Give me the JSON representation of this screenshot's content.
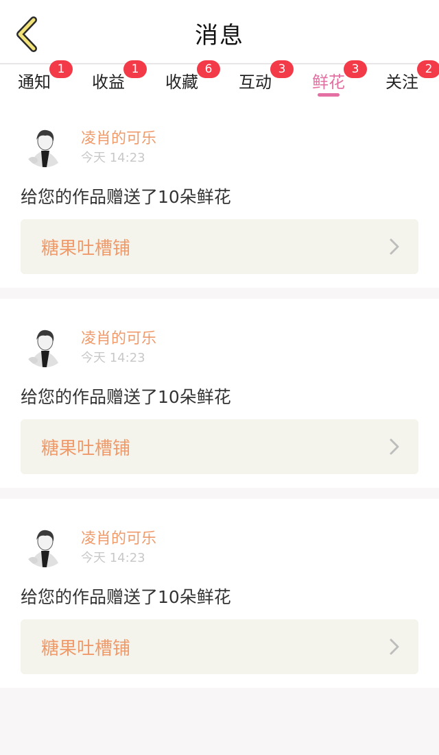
{
  "header": {
    "title": "消息",
    "back_icon": "chevron-left-icon"
  },
  "tabs": [
    {
      "label": "通知",
      "badge": "1",
      "active": false
    },
    {
      "label": "收益",
      "badge": "1",
      "active": false
    },
    {
      "label": "收藏",
      "badge": "6",
      "active": false
    },
    {
      "label": "互动",
      "badge": "3",
      "active": false
    },
    {
      "label": "鲜花",
      "badge": "3",
      "active": true
    },
    {
      "label": "关注",
      "badge": "2",
      "active": false
    }
  ],
  "messages": [
    {
      "author": "凌肖的可乐",
      "time": "今天 14:23",
      "text": "给您的作品赠送了10朵鲜花",
      "work": "糖果吐槽铺"
    },
    {
      "author": "凌肖的可乐",
      "time": "今天 14:23",
      "text": "给您的作品赠送了10朵鲜花",
      "work": "糖果吐槽铺"
    },
    {
      "author": "凌肖的可乐",
      "time": "今天 14:23",
      "text": "给您的作品赠送了10朵鲜花",
      "work": "糖果吐槽铺"
    }
  ],
  "colors": {
    "accent": "#e46fa2",
    "author": "#ef9a6a",
    "badge": "#f23a49",
    "back_arrow_fill": "#f1e27a",
    "work_box": "#f4f4ec"
  }
}
